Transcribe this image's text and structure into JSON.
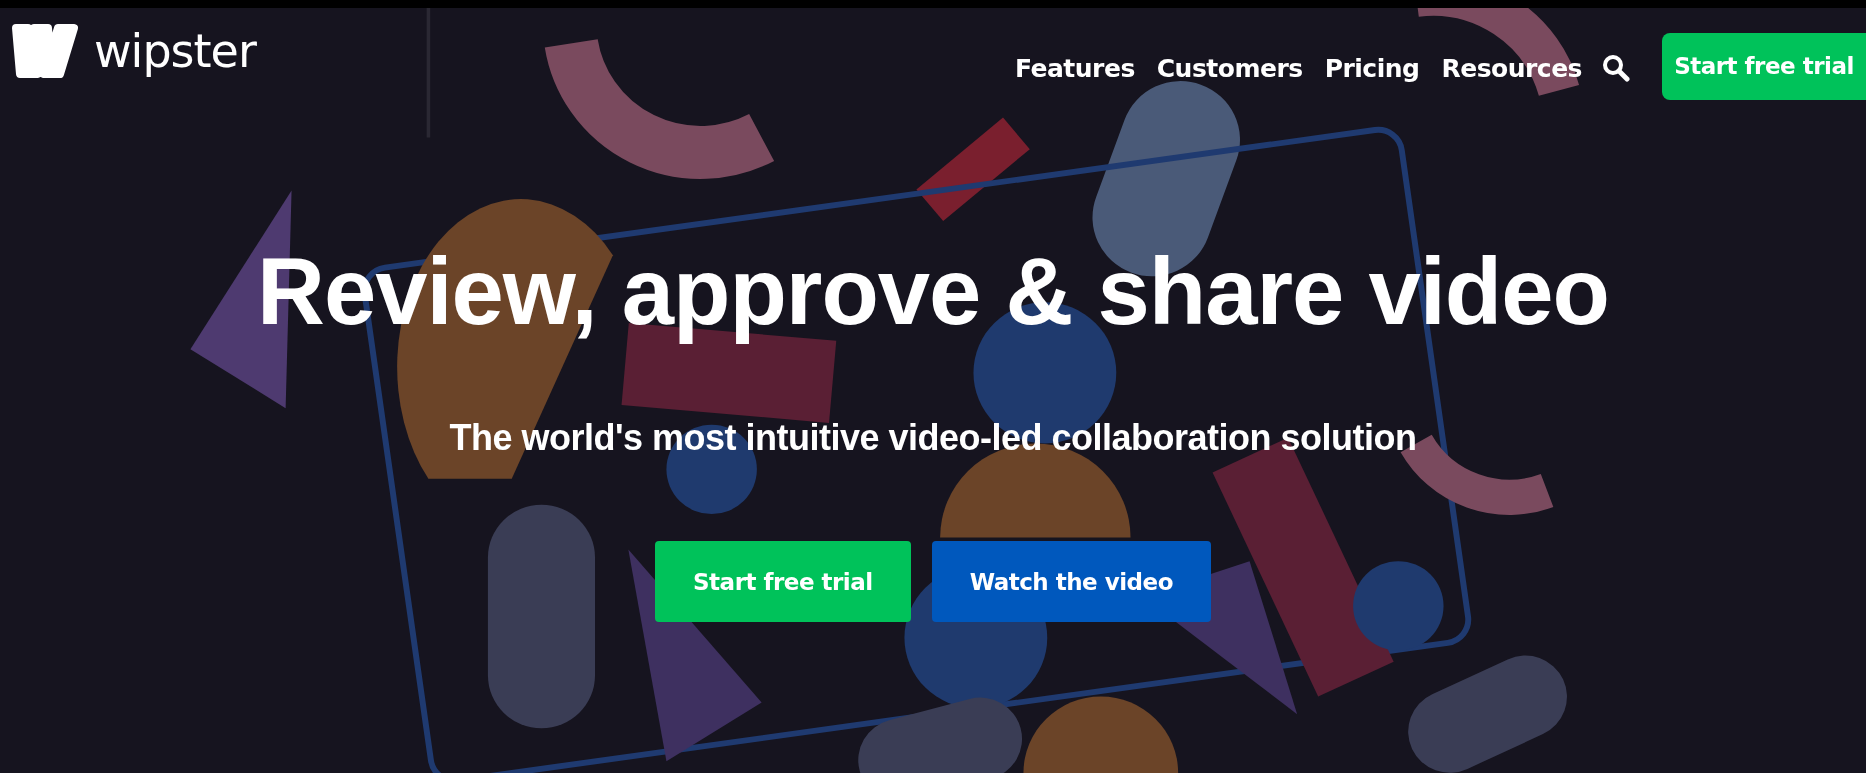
{
  "brand": {
    "name": "wipster"
  },
  "nav": {
    "items": [
      {
        "label": "Features"
      },
      {
        "label": "Customers"
      },
      {
        "label": "Pricing"
      },
      {
        "label": "Resources"
      }
    ],
    "cta": {
      "label": "Start free trial",
      "color": "#00c25a"
    }
  },
  "hero": {
    "headline": "Review, approve & share video",
    "subtitle": "The world's most intuitive video-led collaboration solution",
    "buttons": [
      {
        "label": "Start free trial",
        "color": "#00c25a"
      },
      {
        "label": "Watch the video",
        "color": "#0058bd"
      }
    ]
  }
}
